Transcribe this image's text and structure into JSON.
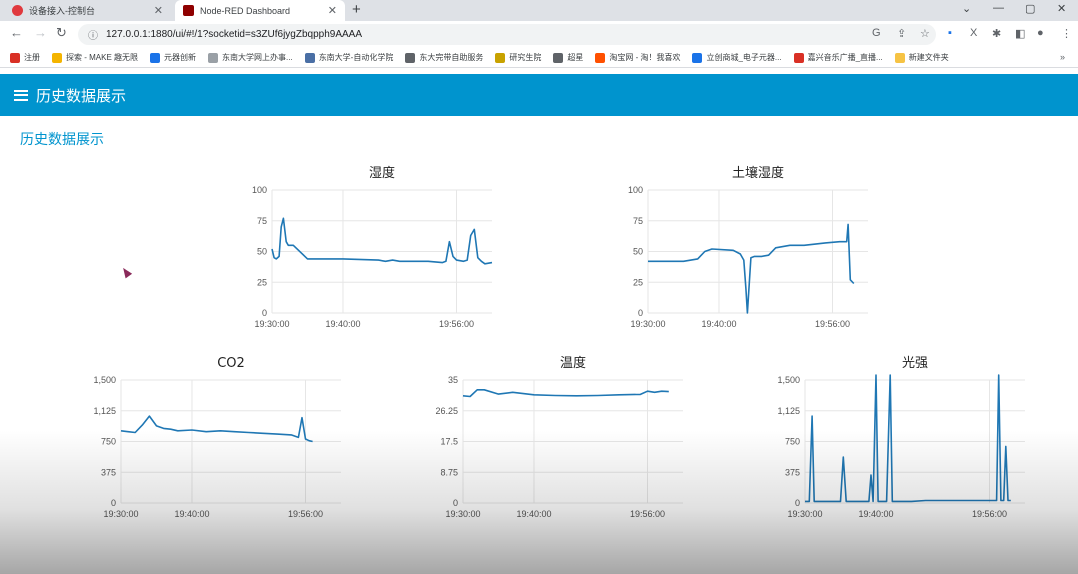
{
  "browser": {
    "tabs": [
      {
        "label": "设备接入-控制台",
        "active": false
      },
      {
        "label": "Node-RED Dashboard",
        "active": true
      }
    ],
    "url": "127.0.0.1:1880/ui/#!/1?socketid=s3ZUf6jygZbqpph9AAAA",
    "bookmarks": [
      {
        "label": "注册",
        "color": "#d93025"
      },
      {
        "label": "探索 - MAKE 趣无限",
        "color": "#f4b400"
      },
      {
        "label": "元器创新",
        "color": "#1a73e8"
      },
      {
        "label": "东南大学网上办事...",
        "color": "#9aa0a6"
      },
      {
        "label": "东南大学-自动化学院",
        "color": "#4a6fa5"
      },
      {
        "label": "东大完带自助服务",
        "color": "#5f6368"
      },
      {
        "label": "研究生院",
        "color": "#c8a200"
      },
      {
        "label": "超星",
        "color": "#5f6368"
      },
      {
        "label": "淘宝网 - 淘！我喜欢",
        "color": "#ff5000"
      },
      {
        "label": "立创商城_电子元器...",
        "color": "#1a73e8"
      },
      {
        "label": "嘉兴音乐广播_直播...",
        "color": "#d93025"
      },
      {
        "label": "新建文件夹",
        "color": "#f6c344"
      }
    ]
  },
  "dashboard": {
    "header_title": "历史数据展示",
    "group_title": "历史数据展示"
  },
  "chart_data": [
    {
      "id": "humidity",
      "type": "line",
      "title": "湿度",
      "ylim": [
        0,
        100
      ],
      "yticks": [
        "0",
        "25",
        "50",
        "75",
        "100"
      ],
      "xticks": [
        "19:30:00",
        "19:40:00",
        "19:56:00"
      ],
      "series": [
        {
          "x_minutes": [
            0,
            0.3,
            0.6,
            1,
            1.3,
            1.6,
            2,
            2.3,
            3,
            5,
            10,
            15,
            16,
            17,
            18,
            20,
            22,
            24,
            24.5,
            25,
            25.5,
            26,
            27,
            27.5,
            28,
            28.5,
            29,
            29.5,
            30,
            31
          ],
          "values": [
            52,
            45,
            44,
            46,
            70,
            77,
            58,
            55,
            55,
            44,
            44,
            43,
            42,
            43,
            42,
            42,
            42,
            41,
            42,
            58,
            46,
            43,
            42,
            43,
            63,
            68,
            45,
            42,
            40,
            41
          ]
        }
      ],
      "color": "#1f77b4"
    },
    {
      "id": "soil_moisture",
      "type": "line",
      "title": "土壤湿度",
      "ylim": [
        0,
        100
      ],
      "yticks": [
        "0",
        "25",
        "50",
        "75",
        "100"
      ],
      "xticks": [
        "19:30:00",
        "19:40:00",
        "19:56:00"
      ],
      "series": [
        {
          "x_minutes": [
            0,
            2,
            5,
            7,
            8,
            9,
            12,
            13,
            13.5,
            13.8,
            14,
            14.5,
            15,
            16,
            17,
            18,
            19,
            20,
            22,
            25,
            27,
            28,
            28.2,
            28.5,
            29
          ],
          "values": [
            42,
            42,
            42,
            44,
            50,
            52,
            51,
            48,
            43,
            20,
            0,
            45,
            46,
            46,
            47,
            53,
            54,
            55,
            55,
            57,
            58,
            58,
            72,
            27,
            24
          ]
        }
      ],
      "color": "#1f77b4"
    },
    {
      "id": "co2",
      "type": "line",
      "title": "CO2",
      "ylim": [
        0,
        1500
      ],
      "yticks": [
        "0",
        "375",
        "750",
        "1,125",
        "1,500"
      ],
      "xticks": [
        "19:30:00",
        "19:40:00",
        "19:56:00"
      ],
      "series": [
        {
          "x_minutes": [
            0,
            1,
            2,
            3,
            4,
            5,
            6,
            7,
            8,
            10,
            12,
            14,
            16,
            18,
            20,
            22,
            24,
            25,
            25.5,
            26,
            26.5,
            27
          ],
          "values": [
            880,
            870,
            860,
            950,
            1060,
            940,
            910,
            900,
            880,
            890,
            870,
            880,
            870,
            860,
            850,
            840,
            830,
            800,
            1040,
            780,
            760,
            750
          ]
        }
      ],
      "color": "#1f77b4"
    },
    {
      "id": "temperature",
      "type": "line",
      "title": "温度",
      "ylim": [
        0,
        35
      ],
      "yticks": [
        "0",
        "8.75",
        "17.5",
        "26.25",
        "35"
      ],
      "xticks": [
        "19:30:00",
        "19:40:00",
        "19:56:00"
      ],
      "series": [
        {
          "x_minutes": [
            0,
            1,
            2,
            3,
            5,
            7,
            10,
            13,
            16,
            19,
            22,
            25,
            26,
            27,
            28,
            29
          ],
          "values": [
            30.5,
            30.3,
            32.2,
            32.2,
            31.0,
            31.5,
            30.8,
            30.6,
            30.5,
            30.6,
            30.8,
            30.9,
            31.8,
            31.5,
            31.8,
            31.7
          ]
        }
      ],
      "color": "#1f77b4"
    },
    {
      "id": "light",
      "type": "line",
      "title": "光强",
      "ylim": [
        0,
        1500
      ],
      "yticks": [
        "0",
        "375",
        "750",
        "1,125",
        "1,500"
      ],
      "xticks": [
        "19:30:00",
        "19:40:00",
        "19:56:00"
      ],
      "series": [
        {
          "x_minutes": [
            0,
            0.6,
            1,
            1.3,
            2,
            4,
            5,
            5.4,
            5.8,
            6,
            8,
            9,
            9.3,
            9.6,
            10,
            10.3,
            10.6,
            11.5,
            12,
            12.3,
            12.6,
            13,
            15,
            17,
            20,
            25,
            26.5,
            27,
            27.3,
            27.6,
            28,
            28.3,
            28.6,
            29
          ],
          "values": [
            20,
            20,
            1060,
            20,
            20,
            20,
            20,
            560,
            20,
            20,
            20,
            20,
            340,
            20,
            1560,
            20,
            20,
            20,
            1560,
            20,
            20,
            20,
            20,
            30,
            30,
            30,
            30,
            30,
            1560,
            30,
            30,
            690,
            30,
            30
          ]
        }
      ],
      "color": "#1f77b4"
    }
  ]
}
